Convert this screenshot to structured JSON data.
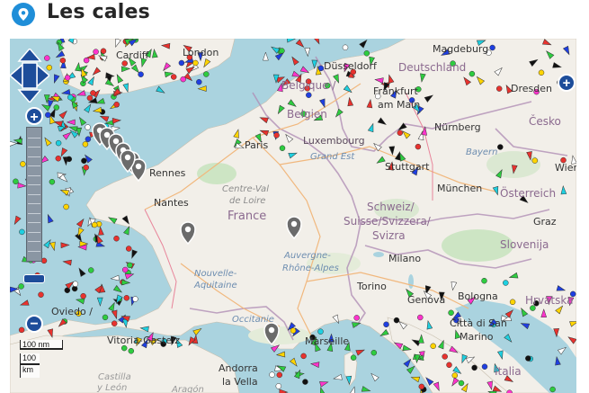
{
  "header": {
    "title": "Les cales",
    "icon": "location-pin-icon"
  },
  "colors": {
    "accent": "#1f8ed8",
    "water": "#aad3df",
    "land": "#f2efe9",
    "border": "#b08fb5",
    "control": "#1d4d9a"
  },
  "map": {
    "countries": [
      {
        "id": "deutschland",
        "name": "Deutschland"
      },
      {
        "id": "belgique",
        "name": "Belgique /"
      },
      {
        "id": "belgien",
        "name": "Belgien"
      },
      {
        "id": "france",
        "name": "France"
      },
      {
        "id": "schweiz1",
        "name": "Schweiz/"
      },
      {
        "id": "schweiz2",
        "name": "Suisse/Svizzera/"
      },
      {
        "id": "schweiz3",
        "name": "Svizra"
      },
      {
        "id": "osterreich",
        "name": "Österreich"
      },
      {
        "id": "cesko",
        "name": "Česko"
      },
      {
        "id": "slovenija",
        "name": "Slovenija"
      },
      {
        "id": "hrvatska",
        "name": "Hrvatska"
      },
      {
        "id": "italia",
        "name": "Italia"
      },
      {
        "id": "luxembourg",
        "name": "Luxembourg"
      },
      {
        "id": "andorra1",
        "name": "Andorra"
      },
      {
        "id": "andorra2",
        "name": "la Vella"
      }
    ],
    "cities": [
      {
        "id": "cardiff",
        "name": "Cardiff"
      },
      {
        "id": "london",
        "name": "London"
      },
      {
        "id": "dusseldorf",
        "name": "Düsseldorf"
      },
      {
        "id": "magdeburg",
        "name": "Magdeburg"
      },
      {
        "id": "frankfurt1",
        "name": "Frankfurt"
      },
      {
        "id": "frankfurt2",
        "name": "am Main"
      },
      {
        "id": "dresden",
        "name": "Dresden"
      },
      {
        "id": "nurnberg",
        "name": "Nürnberg"
      },
      {
        "id": "paris",
        "name": "Paris"
      },
      {
        "id": "rennes",
        "name": "Rennes"
      },
      {
        "id": "nantes",
        "name": "Nantes"
      },
      {
        "id": "stuttgart",
        "name": "Stuttgart"
      },
      {
        "id": "munchen",
        "name": "München"
      },
      {
        "id": "wien",
        "name": "Wien"
      },
      {
        "id": "graz",
        "name": "Graz"
      },
      {
        "id": "milano",
        "name": "Milano"
      },
      {
        "id": "torino",
        "name": "Torino"
      },
      {
        "id": "genova",
        "name": "Genova"
      },
      {
        "id": "bologna",
        "name": "Bologna"
      },
      {
        "id": "sanmarino1",
        "name": "Città di San"
      },
      {
        "id": "sanmarino2",
        "name": "Marino"
      },
      {
        "id": "marseille",
        "name": "Marseille"
      },
      {
        "id": "vitoria",
        "name": "Vitoria-Gasteiz"
      },
      {
        "id": "oviedo",
        "name": "Oviedo /"
      }
    ],
    "regions": [
      {
        "id": "grandest",
        "name": "Grand Est"
      },
      {
        "id": "centre1",
        "name": "Centre-Val"
      },
      {
        "id": "centre2",
        "name": "de Loire"
      },
      {
        "id": "auvergne1",
        "name": "Auvergne-"
      },
      {
        "id": "auvergne2",
        "name": "Rhône-Alpes"
      },
      {
        "id": "nouvelle1",
        "name": "Nouvelle-"
      },
      {
        "id": "nouvelle2",
        "name": "Aquitaine"
      },
      {
        "id": "occitanie",
        "name": "Occitanie"
      },
      {
        "id": "bayern",
        "name": "Bayern"
      },
      {
        "id": "castilla1",
        "name": "Castilla"
      },
      {
        "id": "castilla2",
        "name": "y León"
      },
      {
        "id": "aragon",
        "name": "Aragón"
      }
    ],
    "markers": [
      {
        "id": "m1"
      },
      {
        "id": "m2"
      },
      {
        "id": "m3"
      },
      {
        "id": "m4"
      },
      {
        "id": "m5"
      },
      {
        "id": "m6"
      },
      {
        "id": "m7"
      },
      {
        "id": "m8"
      },
      {
        "id": "m9"
      },
      {
        "id": "m10"
      }
    ]
  },
  "controls": {
    "zoom_in_label": "+",
    "zoom_out_label": "−",
    "layer_switcher_label": "+"
  },
  "scale": {
    "nm": "100 nm",
    "mi": "100",
    "km": "km"
  }
}
